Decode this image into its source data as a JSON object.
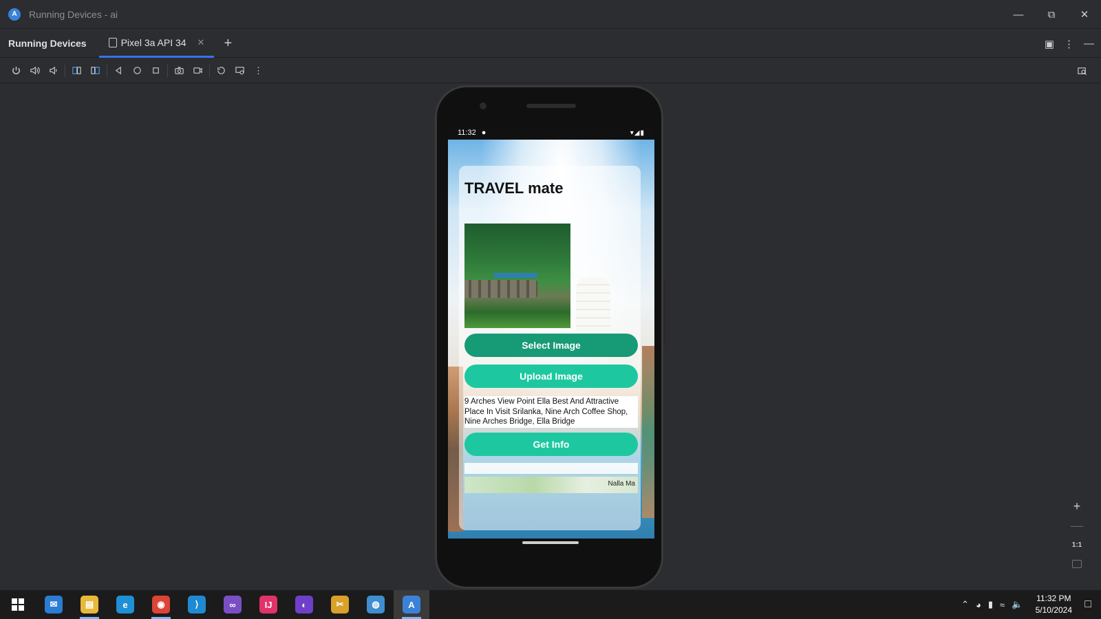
{
  "window": {
    "title": "Running Devices - ai"
  },
  "panel": {
    "title": "Running Devices"
  },
  "tabs": [
    {
      "label": "Pixel 3a API 34"
    }
  ],
  "device": {
    "status_time": "11:32",
    "status_right": "▾◢▮"
  },
  "app": {
    "title": "TRAVEL mate",
    "select_button": "Select Image",
    "upload_button": "Upload Image",
    "result_text": "9 Arches View Point Ella Best And Attractive Place In Visit Srilanka, Nine Arch Coffee Shop, Nine Arches Bridge, Ella Bridge",
    "info_button": "Get Info",
    "map_label": "Nalla Ma"
  },
  "zoom": {
    "reset_label": "1:1"
  },
  "taskbar": {
    "apps": [
      {
        "name": "mail",
        "color": "#2b7cd3",
        "glyph": "✉"
      },
      {
        "name": "file-explorer",
        "color": "#e8b83a",
        "glyph": "▤"
      },
      {
        "name": "edge",
        "color": "#1f8fd6",
        "glyph": "e"
      },
      {
        "name": "chrome",
        "color": "#db4437",
        "glyph": "◉"
      },
      {
        "name": "vscode",
        "color": "#1f8ad2",
        "glyph": "⟩"
      },
      {
        "name": "visual-studio",
        "color": "#7b4fc4",
        "glyph": "∞"
      },
      {
        "name": "intellij",
        "color": "#e0336a",
        "glyph": "IJ"
      },
      {
        "name": "github-desktop",
        "color": "#6e40c9",
        "glyph": "◐"
      },
      {
        "name": "app-tool",
        "color": "#d8a12a",
        "glyph": "✂"
      },
      {
        "name": "globe-app",
        "color": "#3e8ed0",
        "glyph": "◍"
      },
      {
        "name": "android-studio",
        "color": "#3b82d6",
        "glyph": "A"
      }
    ],
    "time": "11:32 PM",
    "date": "5/10/2024"
  }
}
